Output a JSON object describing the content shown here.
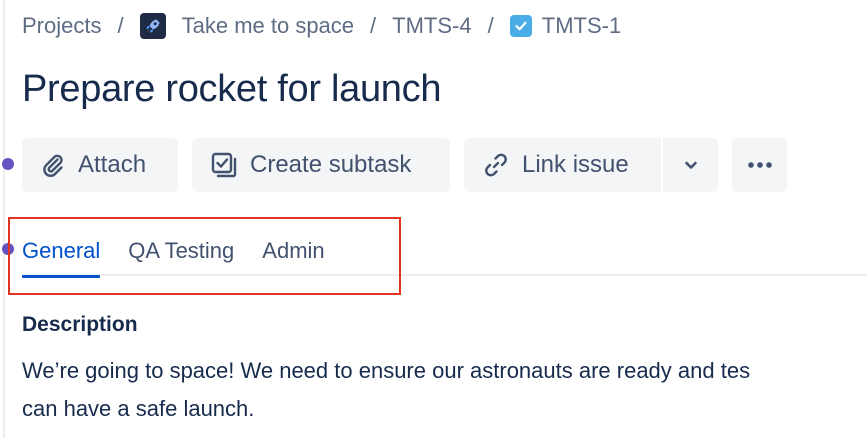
{
  "breadcrumb": {
    "projects": "Projects",
    "project_name": "Take me to space",
    "parent_key": "TMTS-4",
    "issue_key": "TMTS-1",
    "separator": "/"
  },
  "issue": {
    "title": "Prepare rocket for launch"
  },
  "toolbar": {
    "attach_label": "Attach",
    "create_subtask_label": "Create subtask",
    "link_issue_label": "Link issue"
  },
  "tabs": [
    {
      "label": "General",
      "active": true
    },
    {
      "label": "QA Testing",
      "active": false
    },
    {
      "label": "Admin",
      "active": false
    }
  ],
  "description": {
    "heading": "Description",
    "line1": "We’re going to space! We need to ensure our astronauts are ready and tes",
    "line2": "can have a safe launch."
  },
  "colors": {
    "accent": "#0052CC",
    "text_primary": "#172B4D",
    "text_subtle": "#5E6C84",
    "button_bg": "#F4F5F7",
    "highlight": "#E0341F",
    "rail_dot": "#6554C0",
    "task_icon": "#4BADE8"
  },
  "icons": {
    "project_avatar": "rocket-icon",
    "issue_type": "task-checkbox-icon",
    "attach": "paperclip-icon",
    "subtask": "subtask-icon",
    "link": "link-icon",
    "dropdown": "chevron-down-icon",
    "more": "more-horizontal-icon"
  }
}
